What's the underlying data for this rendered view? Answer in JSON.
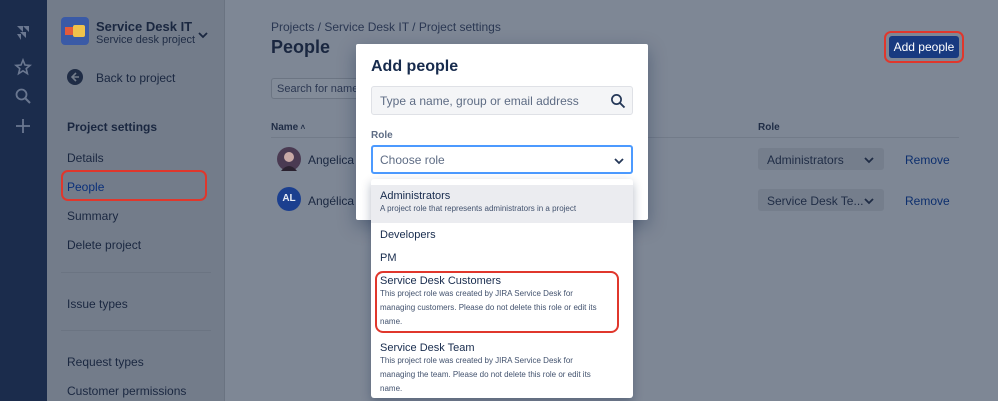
{
  "colors": {
    "accent": "#0052cc",
    "highlight_ring": "#e0372c",
    "nav_bg": "#1b2c4c"
  },
  "global_nav": {
    "icons": [
      "jira-logo-icon",
      "star-icon",
      "search-icon",
      "plus-icon"
    ]
  },
  "sidebar": {
    "project_name": "Service Desk IT",
    "project_type": "Service desk project",
    "back_label": "Back to project",
    "section_title": "Project settings",
    "items": [
      {
        "label": "Details"
      },
      {
        "label": "People"
      },
      {
        "label": "Summary"
      },
      {
        "label": "Delete project"
      },
      {
        "label": "Issue types"
      },
      {
        "label": "Request types"
      },
      {
        "label": "Customer permissions"
      }
    ]
  },
  "main": {
    "breadcrumb": "Projects  /  Service Desk IT  /  Project settings",
    "title": "People",
    "search_placeholder": "Search for names",
    "add_people_label": "Add people",
    "columns": {
      "name": "Name",
      "role": "Role"
    },
    "rows": [
      {
        "name": "Angelica d",
        "role": "Administrators",
        "remove": "Remove"
      },
      {
        "initials": "AL",
        "name": "Angélica L",
        "role": "Service Desk Te...",
        "remove": "Remove"
      }
    ]
  },
  "modal": {
    "title": "Add people",
    "search_placeholder": "Type a name, group or email address",
    "role_label": "Role",
    "role_placeholder": "Choose role",
    "options": [
      {
        "title": "Administrators",
        "desc": "A project role that represents administrators in a project"
      },
      {
        "title": "Developers",
        "desc": ""
      },
      {
        "title": "PM",
        "desc": ""
      },
      {
        "title": "Service Desk Customers",
        "desc1": "This project role was created by JIRA Service Desk for",
        "desc2": "managing customers. Please do not delete this role or edit its",
        "desc3": "name."
      },
      {
        "title": "Service Desk Team",
        "desc1": "This project role was created by JIRA Service Desk for",
        "desc2": "managing the team. Please do not delete this role or edit its",
        "desc3": "name."
      }
    ]
  }
}
